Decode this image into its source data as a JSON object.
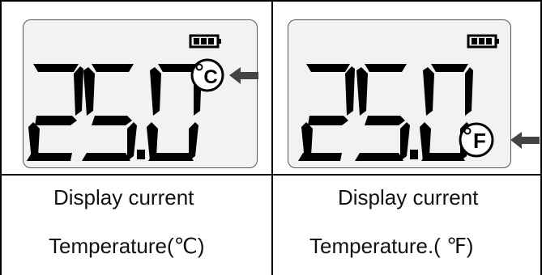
{
  "left_display": {
    "reading": "25.0",
    "unit_symbol": "C",
    "caption_line1": "Display current",
    "caption_line2": "Temperature(℃)"
  },
  "right_display": {
    "reading": "25.0",
    "unit_symbol": "F",
    "caption_line1": "Display current",
    "caption_line2": "Temperature.( ℉)"
  },
  "icons": [
    "battery-icon",
    "arrow-left-icon",
    "degree-unit-icon"
  ],
  "colors": {
    "lcd_background": "#f2f2f2",
    "segment": "#000000",
    "border": "#000000"
  }
}
